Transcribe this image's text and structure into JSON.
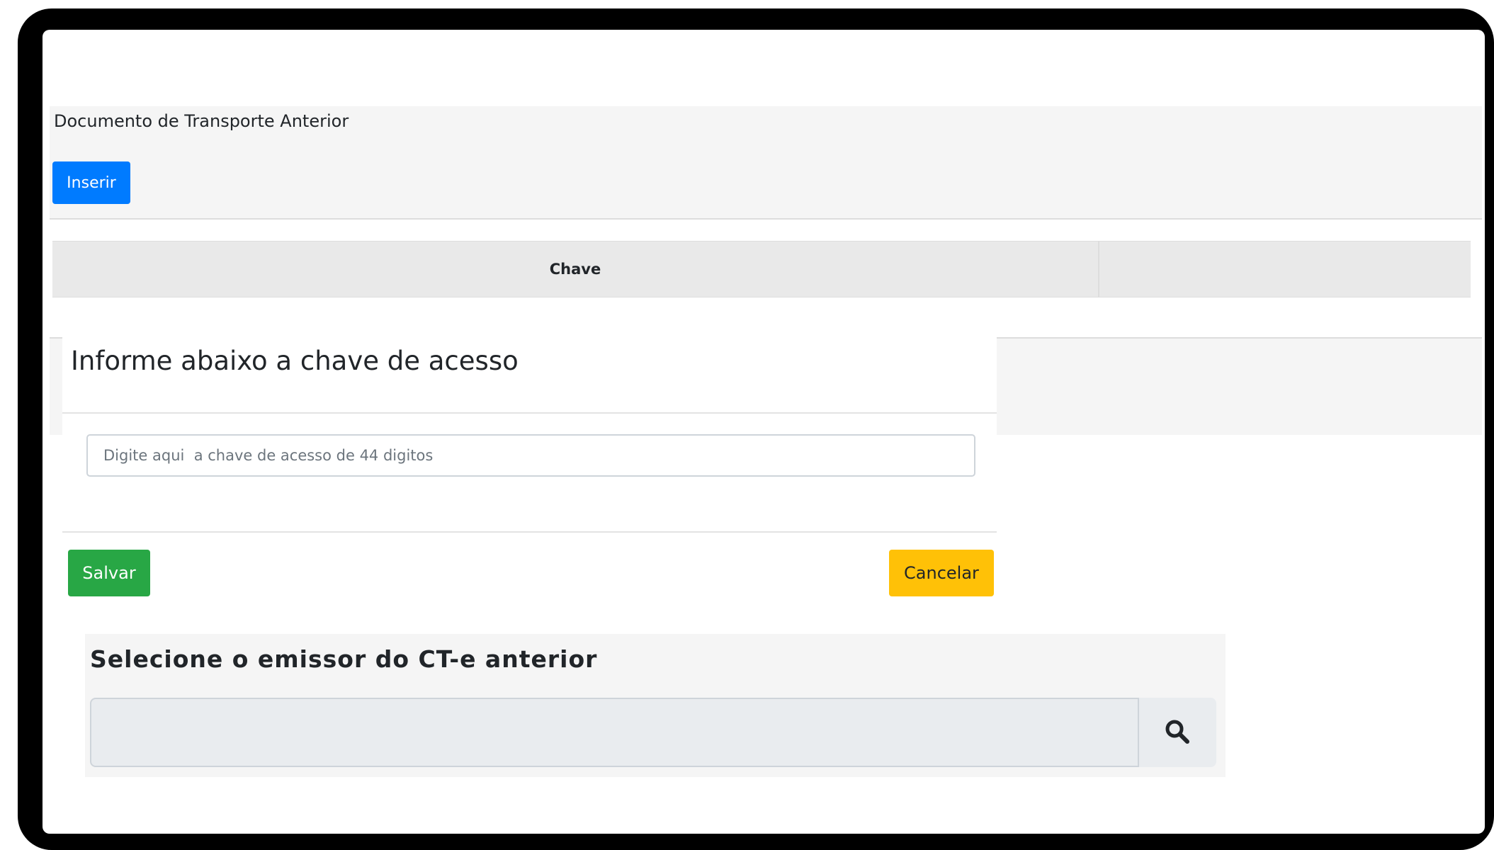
{
  "document_section": {
    "title": "Documento de Transporte Anterior",
    "insert_label": "Inserir"
  },
  "table": {
    "columns": [
      "Chave",
      ""
    ]
  },
  "modal": {
    "title": "Informe abaixo a chave de acesso",
    "input_placeholder": "Digite aqui  a chave de acesso de 44 digitos",
    "input_value": "",
    "save_label": "Salvar",
    "cancel_label": "Cancelar"
  },
  "issuer_section": {
    "title": "Selecione o emissor do CT-e anterior",
    "input_value": "",
    "search_icon": "search-icon"
  },
  "colors": {
    "insert_button": "#007bff",
    "save_button": "#28a745",
    "cancel_button": "#ffc107"
  }
}
